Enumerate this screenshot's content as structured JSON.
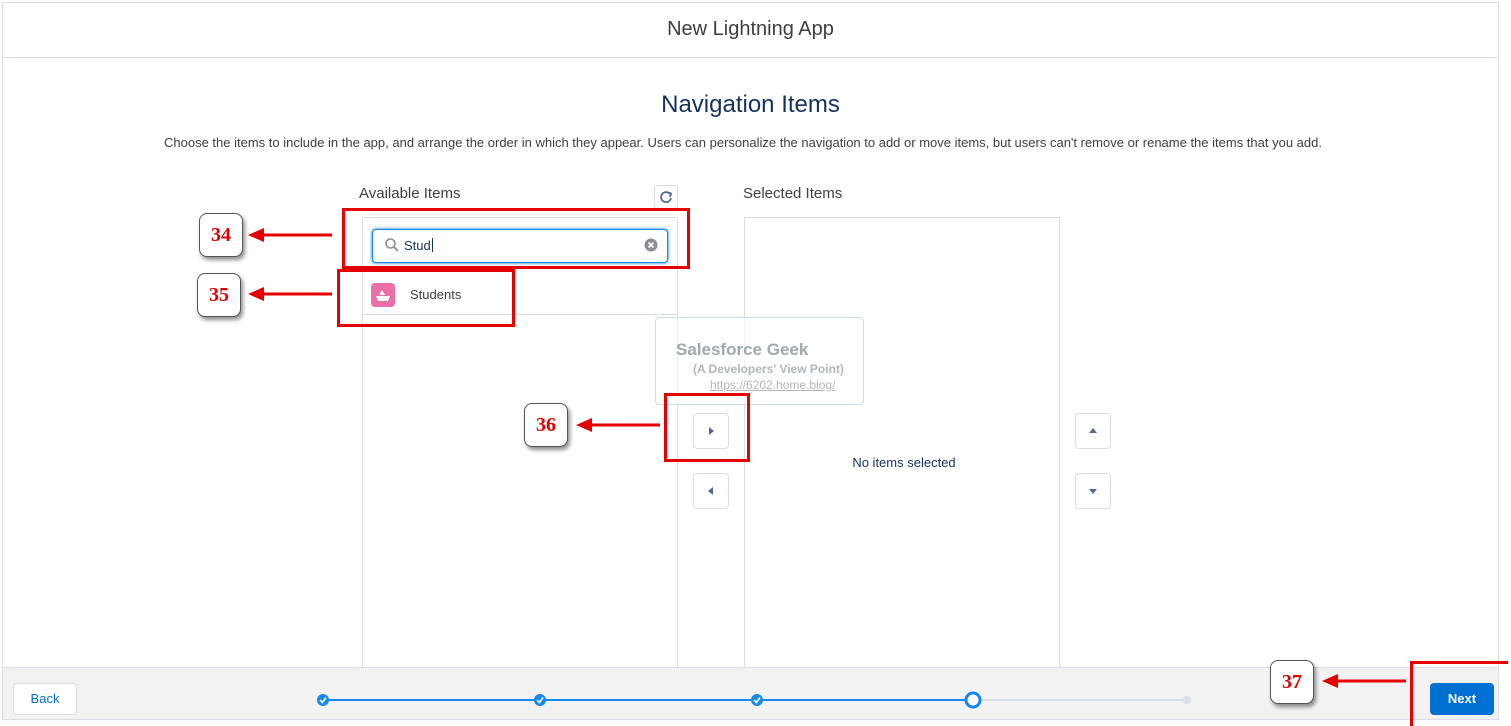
{
  "window": {
    "title": "New Lightning App"
  },
  "page": {
    "heading": "Navigation Items",
    "description": "Choose the items to include in the app, and arrange the order in which they appear. Users can personalize the navigation to add or move items, but users can't remove or rename the items that you add."
  },
  "available": {
    "label": "Available Items",
    "search_value": "Stud",
    "items": [
      {
        "label": "Students",
        "icon": "students-object-icon",
        "icon_color": "#ea6fa7"
      }
    ]
  },
  "selected": {
    "label": "Selected Items",
    "empty_text": "No items selected"
  },
  "footer": {
    "back_label": "Back",
    "next_label": "Next",
    "progress_steps": 5,
    "current_step": 4
  },
  "watermark": {
    "title": "Salesforce Geek",
    "subtitle": "(A Developers' View Point)",
    "url": "https://6202.home.blog/"
  },
  "annotations": {
    "a34": "34",
    "a35": "35",
    "a36": "36",
    "a37": "37",
    "color": "#e00000"
  },
  "colors": {
    "brand": "#0070d2",
    "border": "#d8dde6",
    "progress": "#1589ee"
  }
}
